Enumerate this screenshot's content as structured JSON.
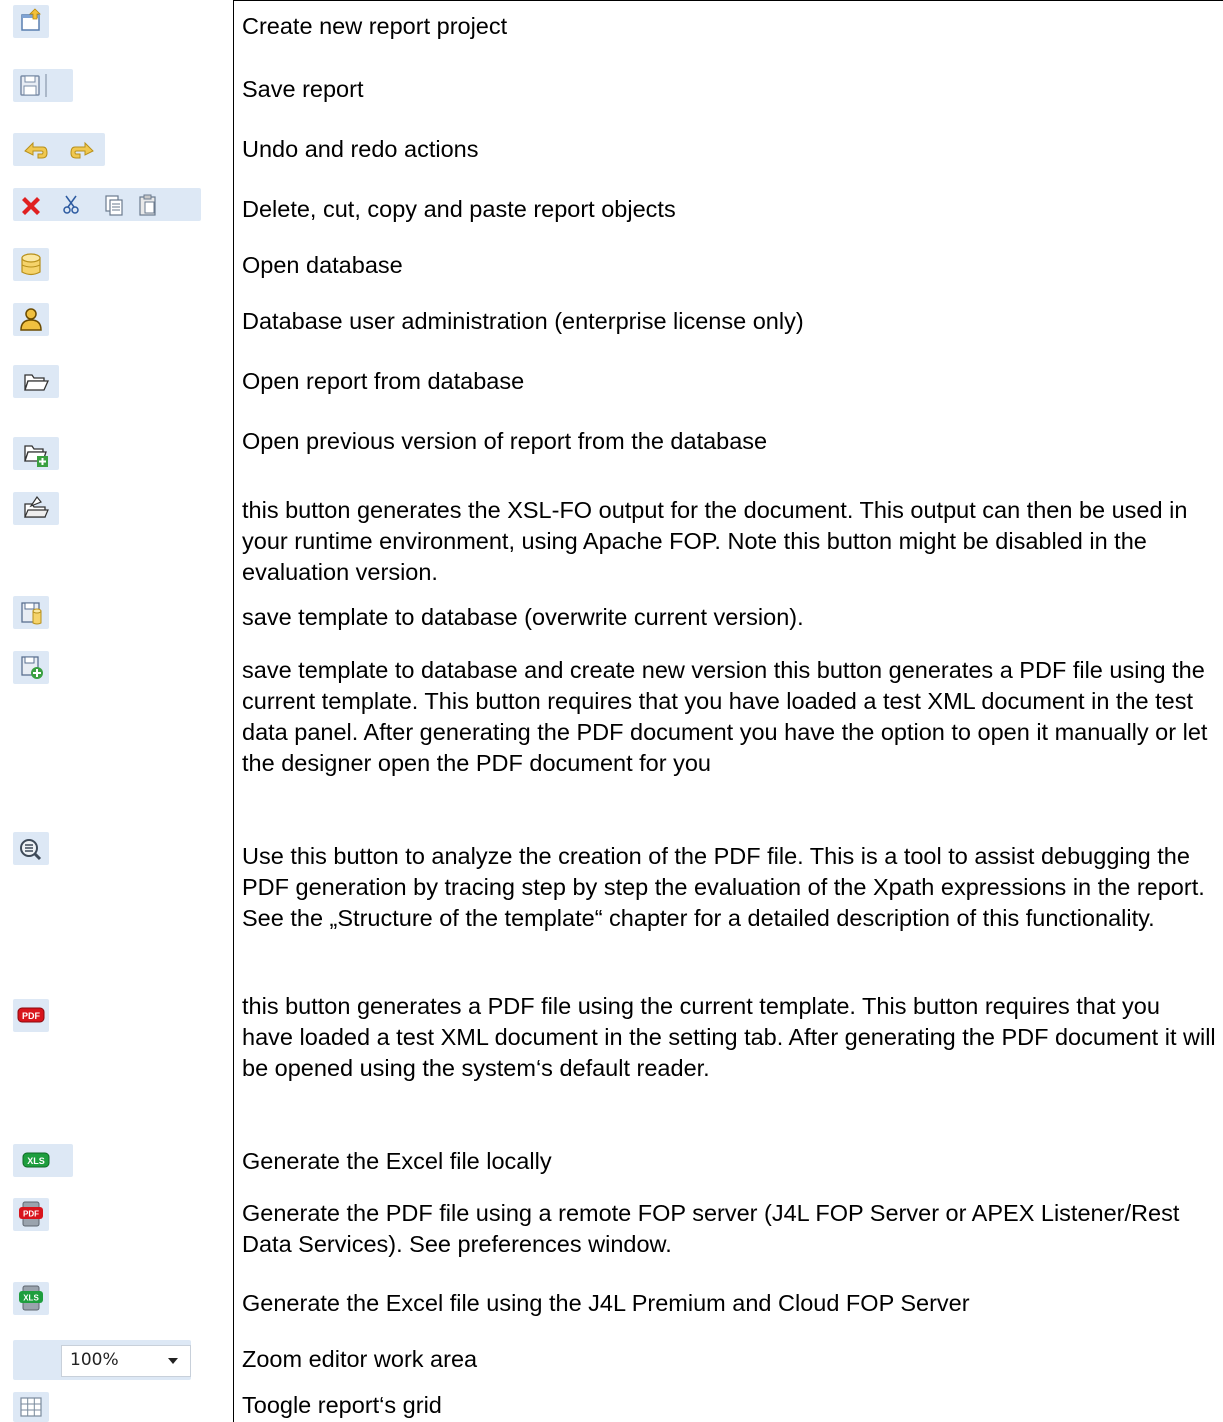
{
  "rows": [
    {
      "icon": "new-project-icon",
      "text": "Create new report project"
    },
    {
      "icon": "save-icon",
      "text": "Save report"
    },
    {
      "icon": "undo-redo-icons",
      "text": "Undo and redo actions"
    },
    {
      "icon": "delete-cut-copy-paste-icons",
      "text": "Delete, cut, copy and paste report objects"
    },
    {
      "icon": "database-icon",
      "text": "Open database"
    },
    {
      "icon": "user-admin-icon",
      "text": "Database user administration (enterprise license only)"
    },
    {
      "icon": "open-folder-icon",
      "text": "Open report from database"
    },
    {
      "icon": "open-previous-version-icon",
      "text": "Open previous version of report from the database"
    },
    {
      "icon": "xslfo-export-icon",
      "text": "this button generates the XSL-FO output for the document. This output can then be used in your runtime environment, using Apache FOP. Note this button might be disabled in the evaluation version."
    },
    {
      "icon": "save-to-database-icon",
      "text": "save template to database (overwrite current version)."
    },
    {
      "icon": "save-new-version-icon",
      "text": "save template to database and create new version this button generates a PDF file using the current template. This button requires that you have loaded a test XML document in the test data panel. After generating the PDF document you have the option to open it manually or let the designer open the PDF document for you"
    },
    {
      "icon": "analyze-icon",
      "text": "Use this button to analyze the creation of the PDF file. This is a tool to assist debugging the PDF generation by tracing step by step the evaluation of the Xpath expressions in the report. See the „Structure of the template“ chapter for a detailed description of this functionality."
    },
    {
      "icon": "pdf-icon",
      "text": "this button generates a PDF file using the current template. This button requires that you have loaded a test XML document in the setting tab. After generating the PDF document  it will be opened using the system‘s default reader."
    },
    {
      "icon": "xls-icon",
      "text": "Generate the Excel file locally"
    },
    {
      "icon": "remote-pdf-icon",
      "text": "Generate the PDF file using a remote FOP server (J4L FOP Server or APEX Listener/Rest Data Services). See preferences window."
    },
    {
      "icon": "remote-xls-icon",
      "text": "Generate the Excel file using the J4L Premium and Cloud FOP Server"
    },
    {
      "icon": "zoom-select",
      "text": "Zoom editor work area",
      "zoom_value": "100%"
    },
    {
      "icon": "grid-icon",
      "text": "Toogle report‘s grid"
    }
  ]
}
